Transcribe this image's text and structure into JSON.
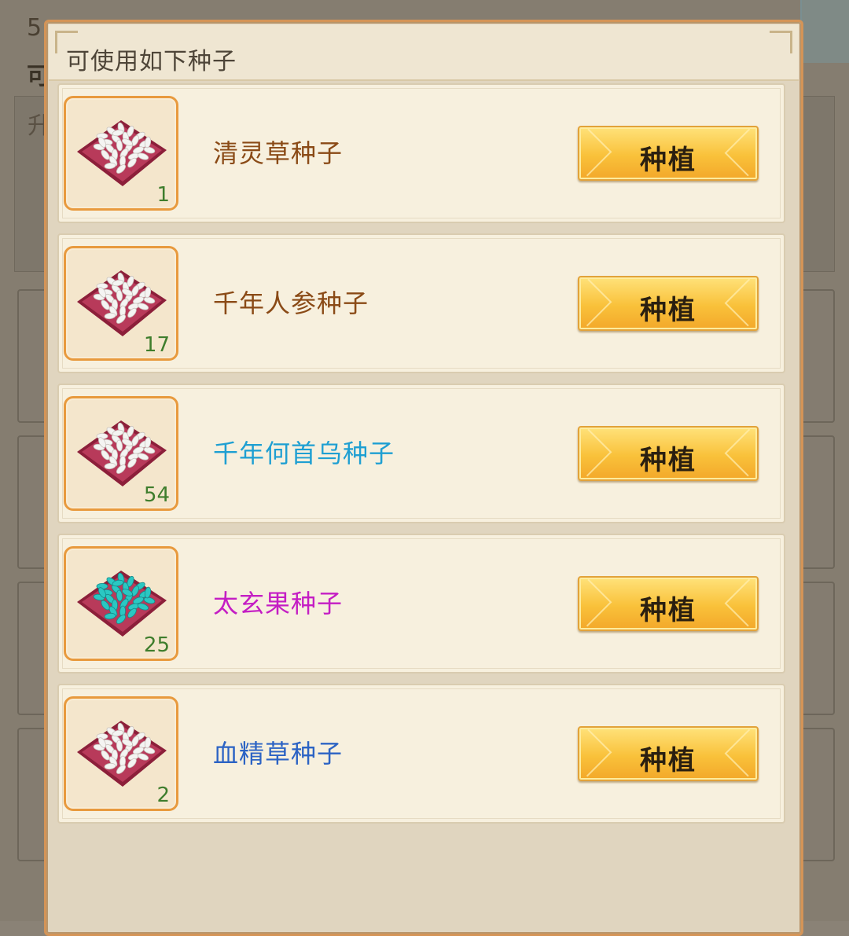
{
  "background": {
    "title_fragment": "5",
    "line2_fragment": "可",
    "box_text_fragment": "升"
  },
  "dialog": {
    "title": "可使用如下种子"
  },
  "seeds": [
    {
      "name": "清灵草种子",
      "count": "1",
      "name_color": "#8a4a16",
      "seed_color": "white",
      "button": "种植"
    },
    {
      "name": "千年人参种子",
      "count": "17",
      "name_color": "#8a4a16",
      "seed_color": "white",
      "button": "种植"
    },
    {
      "name": "千年何首乌种子",
      "count": "54",
      "name_color": "#1e9fd2",
      "seed_color": "white",
      "button": "种植"
    },
    {
      "name": "太玄果种子",
      "count": "25",
      "name_color": "#c41dc4",
      "seed_color": "teal",
      "button": "种植"
    },
    {
      "name": "血精草种子",
      "count": "2",
      "name_color": "#2c63c4",
      "seed_color": "white",
      "button": "种植"
    }
  ],
  "colors": {
    "button_gold": "#f9c13a",
    "count_green": "#3e7d2c",
    "icon_border": "#e89a3e"
  }
}
